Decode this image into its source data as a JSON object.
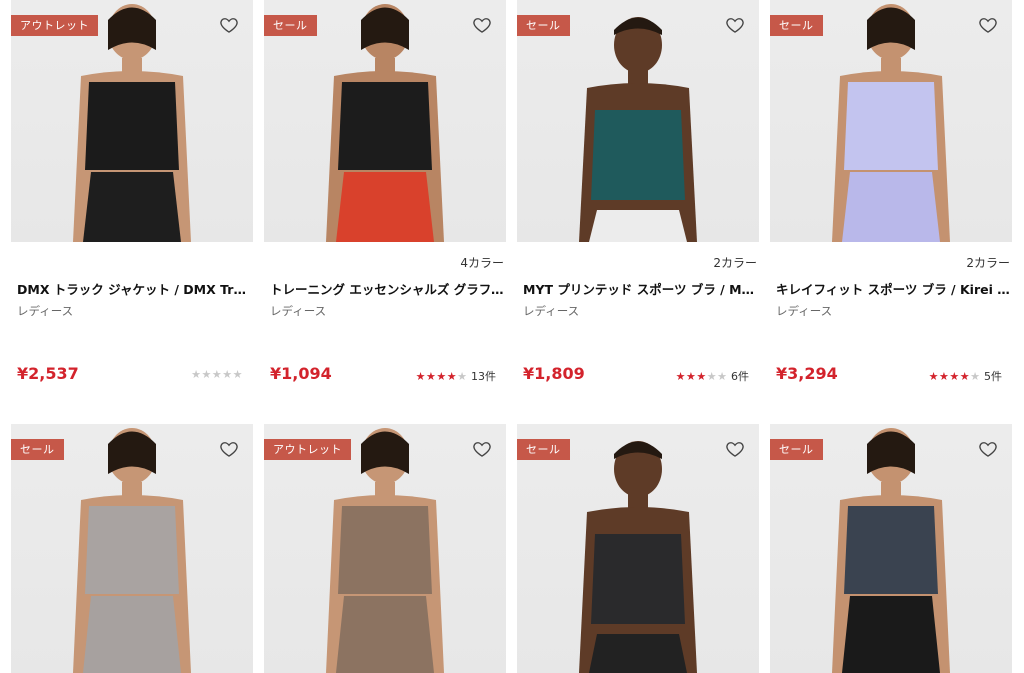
{
  "products": [
    {
      "badge": "アウトレット",
      "colors": "",
      "name": "DMX トラック ジャケット / DMX Track Jacket",
      "gender": "レディース",
      "price": "¥2,537",
      "stars": 0,
      "reviews": "",
      "garment_color": "#1b1b1b",
      "bottom_color": "#1e1e1e",
      "skin": "#c69675"
    },
    {
      "badge": "セール",
      "colors": "4カラー",
      "name": "トレーニング エッセンシャルズ グラフィック タンク",
      "gender": "レディース",
      "price": "¥1,094",
      "stars": 4,
      "reviews": "13件",
      "garment_color": "#1c1c1c",
      "bottom_color": "#d9412c",
      "skin": "#b88563"
    },
    {
      "badge": "セール",
      "colors": "2カラー",
      "name": "MYT プリンテッド スポーツ ブラ / MYT Printed Sports Bra",
      "gender": "レディース",
      "price": "¥1,809",
      "stars": 3,
      "reviews": "6件",
      "garment_color": "#1f5a5c",
      "bottom_color": "#ececec",
      "skin": "#5e3b27"
    },
    {
      "badge": "セール",
      "colors": "2カラー",
      "name": "キレイフィット スポーツ ブラ / Kirei Fit Sports Bra",
      "gender": "レディース",
      "price": "¥3,294",
      "stars": 4,
      "reviews": "5件",
      "garment_color": "#c3c4ef",
      "bottom_color": "#b9b8ea",
      "skin": "#c49270"
    },
    {
      "badge": "セール",
      "colors": "",
      "name": "",
      "gender": "",
      "price": "",
      "stars": 0,
      "reviews": "",
      "garment_color": "#a9a3a1",
      "bottom_color": "#a7a19f",
      "skin": "#c69675"
    },
    {
      "badge": "アウトレット",
      "colors": "",
      "name": "",
      "gender": "",
      "price": "",
      "stars": 0,
      "reviews": "",
      "garment_color": "#8c7361",
      "bottom_color": "#8c7361",
      "skin": "#c69675"
    },
    {
      "badge": "セール",
      "colors": "",
      "name": "",
      "gender": "",
      "price": "",
      "stars": 0,
      "reviews": "",
      "garment_color": "#2a2a2c",
      "bottom_color": "#222",
      "skin": "#5e3b27"
    },
    {
      "badge": "セール",
      "colors": "",
      "name": "",
      "gender": "",
      "price": "",
      "stars": 0,
      "reviews": "",
      "garment_color": "#3a4350",
      "bottom_color": "#1a1a1a",
      "skin": "#c49270"
    }
  ]
}
